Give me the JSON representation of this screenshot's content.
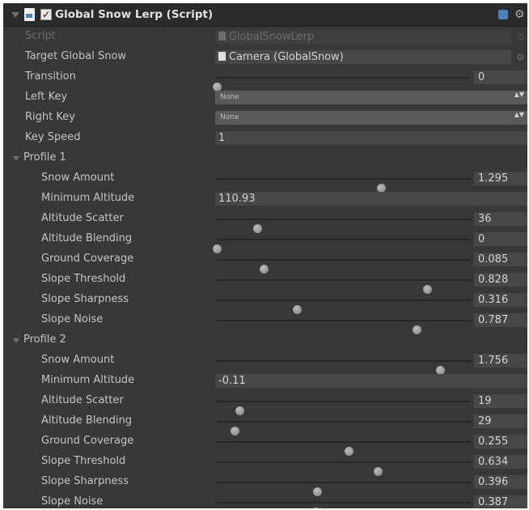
{
  "component": {
    "title": "Global Snow Lerp (Script)",
    "enabled": true,
    "checkbox_mark": "✓",
    "help_icon": "help-book-icon",
    "settings_icon": "gear-icon",
    "settings_glyph": "⚙"
  },
  "fields": {
    "script": {
      "label": "Script",
      "value": "GlobalSnowLerp"
    },
    "target": {
      "label": "Target Global Snow",
      "value": "Camera (GlobalSnow)"
    },
    "transition": {
      "label": "Transition",
      "value": "0",
      "fraction": 0.0
    },
    "left_key": {
      "label": "Left Key",
      "value": "None"
    },
    "right_key": {
      "label": "Right Key",
      "value": "None"
    },
    "key_speed": {
      "label": "Key Speed",
      "value": "1"
    }
  },
  "picker_glyph": "⊙",
  "dropdown_arrows": "▲▼",
  "profiles": [
    {
      "label": "Profile 1",
      "snow_amount": {
        "label": "Snow Amount",
        "value": "1.295",
        "fraction": 0.648
      },
      "min_altitude": {
        "label": "Minimum Altitude",
        "value": "110.93"
      },
      "altitude_scatter": {
        "label": "Altitude Scatter",
        "value": "36",
        "fraction": 0.16
      },
      "altitude_blending": {
        "label": "Altitude Blending",
        "value": "0",
        "fraction": 0.0
      },
      "ground_coverage": {
        "label": "Ground Coverage",
        "value": "0.085",
        "fraction": 0.185
      },
      "slope_threshold": {
        "label": "Slope Threshold",
        "value": "0.828",
        "fraction": 0.828
      },
      "slope_sharpness": {
        "label": "Slope Sharpness",
        "value": "0.316",
        "fraction": 0.316
      },
      "slope_noise": {
        "label": "Slope Noise",
        "value": "0.787",
        "fraction": 0.787
      }
    },
    {
      "label": "Profile 2",
      "snow_amount": {
        "label": "Snow Amount",
        "value": "1.756",
        "fraction": 0.878
      },
      "min_altitude": {
        "label": "Minimum Altitude",
        "value": "-0.11"
      },
      "altitude_scatter": {
        "label": "Altitude Scatter",
        "value": "19",
        "fraction": 0.09
      },
      "altitude_blending": {
        "label": "Altitude Blending",
        "value": "29",
        "fraction": 0.07
      },
      "ground_coverage": {
        "label": "Ground Coverage",
        "value": "0.255",
        "fraction": 0.52
      },
      "slope_threshold": {
        "label": "Slope Threshold",
        "value": "0.634",
        "fraction": 0.634
      },
      "slope_sharpness": {
        "label": "Slope Sharpness",
        "value": "0.396",
        "fraction": 0.396
      },
      "slope_noise": {
        "label": "Slope Noise",
        "value": "0.387",
        "fraction": 0.387
      }
    }
  ]
}
